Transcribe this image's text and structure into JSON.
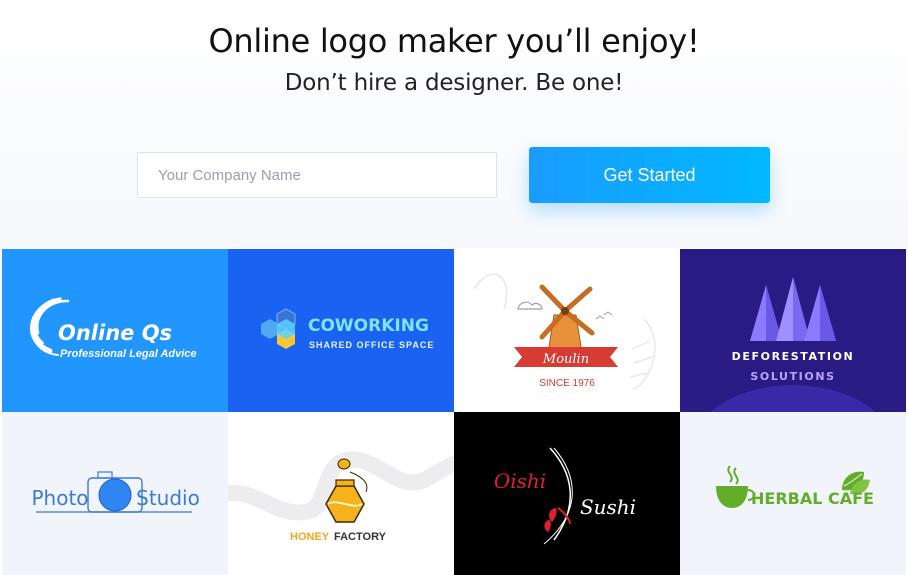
{
  "hero": {
    "title": "Online logo maker you’ll enjoy!",
    "subtitle": "Don’t hire a designer. Be one!",
    "input_placeholder": "Your Company Name",
    "input_value": "",
    "cta_label": "Get Started"
  },
  "tiles": [
    {
      "name": "Online Qs",
      "tagline": "Professional Legal Advice",
      "bg": "#2196ff"
    },
    {
      "name": "COWORKING",
      "tagline": "SHARED OFFICE SPACE",
      "bg": "#1a63f2"
    },
    {
      "name": "Moulin",
      "tagline": "SINCE 1976",
      "bg": "#ffffff"
    },
    {
      "name": "Deforestation",
      "tagline": "Solutions",
      "bg": "#2a1a84"
    },
    {
      "name": "Photo",
      "tagline": "Studio",
      "bg": "#f2f4fb"
    },
    {
      "name": "HONEY",
      "tagline": "FACTORY",
      "bg": "#ffffff"
    },
    {
      "name": "Oishi",
      "tagline": "Sushi",
      "bg": "#000000"
    },
    {
      "name": "HERBAL CAFE",
      "tagline": "",
      "bg": "#f2f4fb"
    }
  ],
  "colors": {
    "accent": "#1a9cff",
    "text": "#111111"
  }
}
